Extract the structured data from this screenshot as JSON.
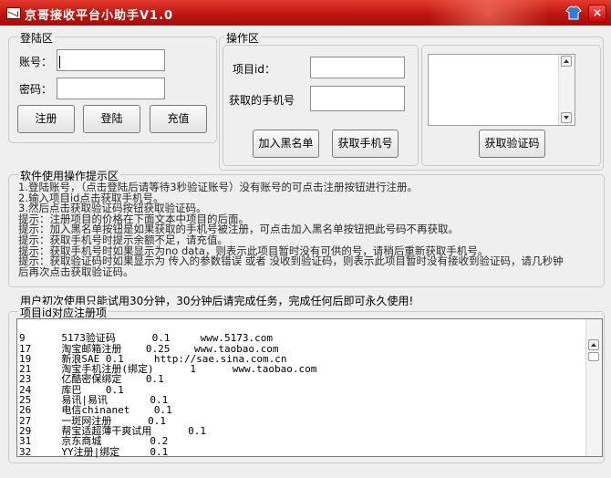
{
  "window": {
    "title": "京哥接收平台小助手V1.0"
  },
  "login": {
    "group_label": "登陆区",
    "account_label": "账号：",
    "password_label": "密码：",
    "account_value": "",
    "password_value": "",
    "register_button": "注册",
    "login_button": "登陆",
    "recharge_button": "充值"
  },
  "operation": {
    "group_label": "操作区",
    "project_id_label": "项目id：",
    "phone_label": "获取的手机号",
    "project_id_value": "",
    "phone_value": "",
    "blacklist_button": "加入黑名单",
    "get_phone_button": "获取手机号",
    "code_output": "",
    "get_code_button": "获取验证码"
  },
  "tips": {
    "group_label": "软件使用操作提示区",
    "lines": [
      "1.登陆账号，（点击登陆后请等待3秒验证账号）没有账号的可点击注册按钮进行注册。",
      "2.输入项目id点击获取手机号。",
      "3.然后点击获取验证码按钮获取验证码。",
      "提示：注册项目的价格在下面文本中项目的后面。",
      "提示：加入黑名单按钮是如果获取的手机号被注册，可点击加入黑名单按钮把此号码不再获取。",
      "提示：获取手机号时提示余额不足，请充值。",
      "提示：获取手机号时如果显示为no data，则表示此项目暂时没有可供的号，请稍后重新获取手机号。",
      "提示：获取验证码时如果显示为 传入的参数错误 或者 没收到验证码，则表示此项目暂时没有接收到验证码，请几秒钟",
      "后再次点击获取验证码。"
    ]
  },
  "note": "用户初次使用只能试用30分钟，30分钟后请完成任务，完成任何后即可永久使用!",
  "project_list": {
    "group_label": "项目id对应注册项",
    "rows": [
      "9      5173验证码      0.1     www.5173.com",
      "17     淘宝邮箱注册    0.25    www.taobao.com",
      "19     新浪SAE 0.1     http://sae.sina.com.cn",
      "21     淘宝手机注册(绑定)      1      www.taobao.com",
      "23     亿酷密保绑定    0.1",
      "24     库巴    0.1",
      "25     易讯|易讯       0.1",
      "26     电信chinanet    0.1",
      "27     一斑网注册      0.1",
      "29     帮宝适超薄干爽试用      0.1",
      "31     京东商城        0.2",
      "32     YY注册|绑定     0.1"
    ]
  }
}
